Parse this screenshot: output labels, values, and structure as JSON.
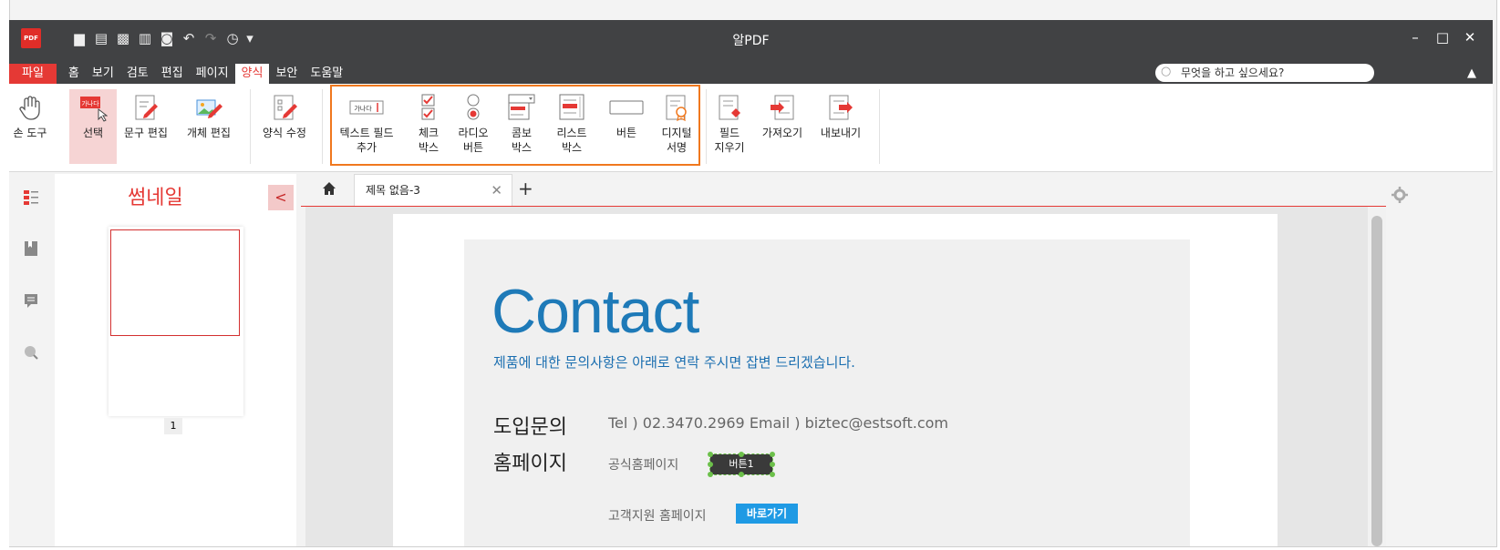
{
  "app": {
    "title": "알PDF",
    "logo_text": "PDF",
    "quick_access_icons": [
      "folder-open-icon",
      "save-icon",
      "save-as-icon",
      "print-icon",
      "print-preview-icon",
      "undo-icon",
      "redo-icon",
      "recent-icon",
      "customize-icon"
    ]
  },
  "window_controls": {
    "minimize": "–",
    "maximize": "□",
    "close": "✕"
  },
  "menu": {
    "items": [
      "파일",
      "홈",
      "보기",
      "검토",
      "편집",
      "페이지",
      "양식",
      "보안",
      "도움말"
    ],
    "active": "양식"
  },
  "search": {
    "placeholder": "무엇을 하고 싶으세요?"
  },
  "ribbon": {
    "groups": [
      [
        {
          "label1": "손 도구",
          "label2": ""
        },
        {
          "label1": "선택",
          "label2": "",
          "icon_text": "가나다"
        },
        {
          "label1": "문구 편집",
          "label2": ""
        },
        {
          "label1": "개체 편집",
          "label2": ""
        }
      ],
      [
        {
          "label1": "양식 수정",
          "label2": ""
        }
      ],
      [
        {
          "label1": "텍스트 필드",
          "label2": "추가",
          "icon_text": "가나다"
        },
        {
          "label1": "체크",
          "label2": "박스"
        },
        {
          "label1": "라디오",
          "label2": "버튼"
        },
        {
          "label1": "콤보",
          "label2": "박스"
        },
        {
          "label1": "리스트",
          "label2": "박스"
        },
        {
          "label1": "버튼",
          "label2": ""
        },
        {
          "label1": "디지털",
          "label2": "서명"
        }
      ],
      [
        {
          "label1": "필드",
          "label2": "지우기"
        },
        {
          "label1": "가져오기",
          "label2": ""
        },
        {
          "label1": "내보내기",
          "label2": ""
        }
      ]
    ]
  },
  "thumbnail_panel": {
    "title": "썸네일",
    "page_number": "1"
  },
  "tabs": {
    "active_label": "제목 없음-3"
  },
  "document": {
    "title": "Contact",
    "subtitle": "제품에 대한 문의사항은 아래로 연락 주시면 잡변 드리겠습니다.",
    "row1_label": "도입문의",
    "row1_text": "Tel ) 02.3470.2969   Email ) biztec@estsoft.com",
    "row2_label": "홈페이지",
    "row2_line1": "공식홈페이지",
    "button_field_label": "버튼1",
    "row2_line2": "고객지원 홈페이지",
    "goto_button": "바로가기"
  },
  "colors": {
    "accent": "#e53935",
    "highlight_box": "#f0781e",
    "contact_blue": "#1e7ab8"
  }
}
